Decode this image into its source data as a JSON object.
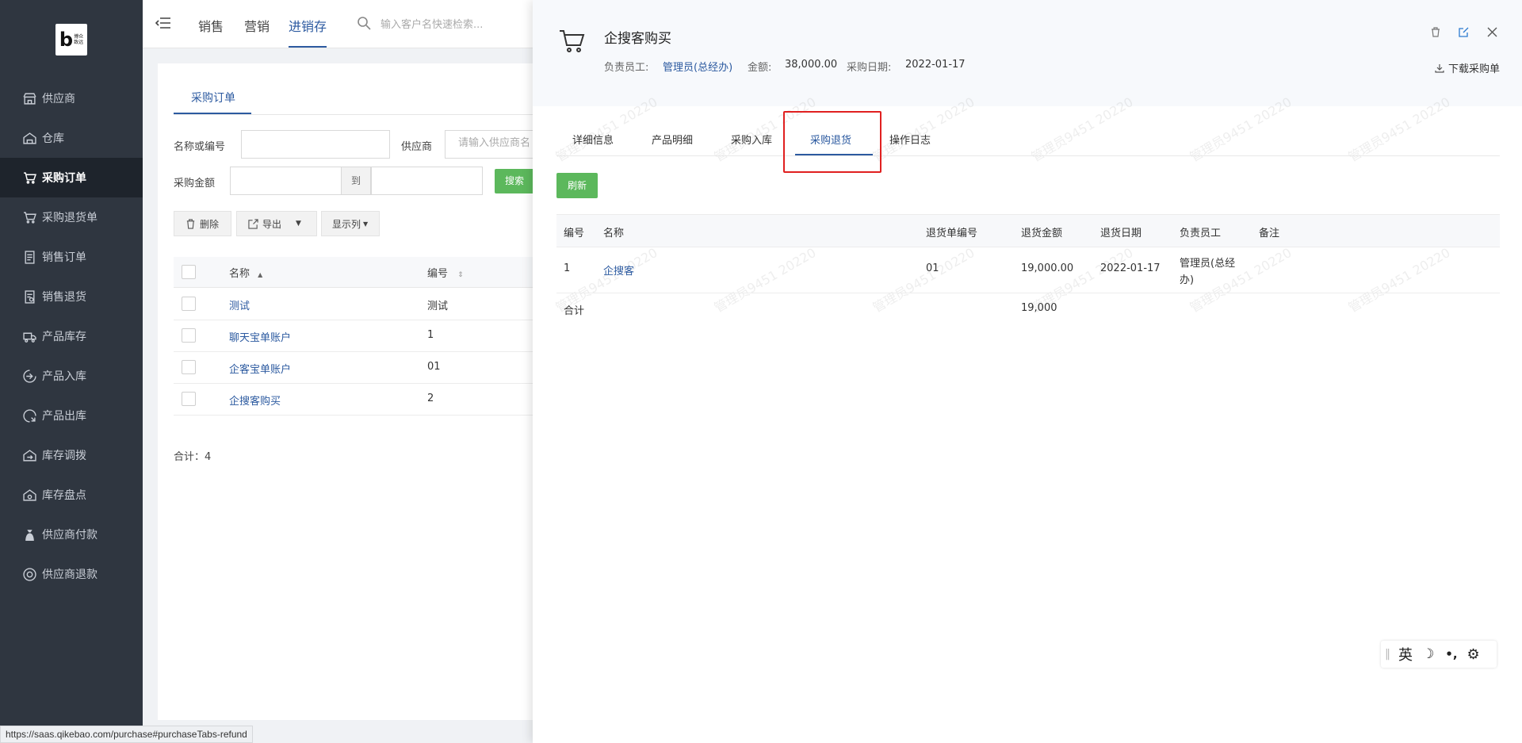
{
  "sidebar": {
    "logo_text": "博众\n致远",
    "items": [
      {
        "label": "供应商",
        "icon": "store-icon"
      },
      {
        "label": "仓库",
        "icon": "warehouse-icon"
      },
      {
        "label": "采购订单",
        "icon": "cart-icon"
      },
      {
        "label": "采购退货单",
        "icon": "return-cart-icon"
      },
      {
        "label": "销售订单",
        "icon": "document-icon"
      },
      {
        "label": "销售退货",
        "icon": "document-return-icon"
      },
      {
        "label": "产品库存",
        "icon": "truck-icon"
      },
      {
        "label": "产品入库",
        "icon": "inbound-icon"
      },
      {
        "label": "产品出库",
        "icon": "outbound-icon"
      },
      {
        "label": "库存调拨",
        "icon": "transfer-icon"
      },
      {
        "label": "库存盘点",
        "icon": "inventory-check-icon"
      },
      {
        "label": "供应商付款",
        "icon": "money-bag-icon"
      },
      {
        "label": "供应商退款",
        "icon": "refund-icon"
      }
    ],
    "active_index": 2
  },
  "topbar": {
    "tabs": [
      "销售",
      "营销",
      "进销存"
    ],
    "active_tab": "进销存",
    "search_placeholder": "输入客户名快速检索..."
  },
  "main": {
    "tab": "采购订单",
    "filters": {
      "name_label": "名称或编号",
      "supplier_label": "供应商",
      "supplier_placeholder": "请输入供应商名",
      "amount_label": "采购金额",
      "to_label": "到",
      "search_button": "搜索"
    },
    "toolbar": {
      "delete": "删除",
      "export": "导出",
      "columns": "显示列"
    },
    "columns": {
      "name": "名称",
      "code": "编号"
    },
    "rows": [
      {
        "name": "测试",
        "code": "测试"
      },
      {
        "name": "聊天宝单账户",
        "code": "1"
      },
      {
        "name": "企客宝单账户",
        "code": "01"
      },
      {
        "name": "企搜客购买",
        "code": "2"
      }
    ],
    "total": "合计：4"
  },
  "drawer": {
    "title": "企搜客购买",
    "owner_label": "负责员工:",
    "owner_value": "管理员(总经办)",
    "amount_label": "金额:",
    "amount_value": "38,000.00",
    "date_label": "采购日期:",
    "date_value": "2022-01-17",
    "download": "下载采购单",
    "tabs": [
      "详细信息",
      "产品明细",
      "采购入库",
      "采购退货",
      "操作日志"
    ],
    "active_tab": "采购退货",
    "refresh": "刷新",
    "table": {
      "headers": [
        "编号",
        "名称",
        "退货单编号",
        "退货金额",
        "退货日期",
        "负责员工",
        "备注"
      ],
      "row": {
        "id": "1",
        "name": "企搜客",
        "return_no": "01",
        "amount": "19,000.00",
        "date": "2022-01-17",
        "owner_line1": "管理员(总经",
        "owner_line2": "办)"
      },
      "sum_label": "合计",
      "sum_value": "19,000"
    },
    "watermark": "管理员9451 20220"
  },
  "ime": {
    "lang": "英",
    "moon": "☽",
    "punct": "•,",
    "gear": "⚙"
  },
  "status_url": "https://saas.qikebao.com/purchase#purchaseTabs-refund",
  "colors": {
    "accent": "#2c5aa0",
    "green": "#5cb85c",
    "sidebar": "#2f3640",
    "highlight": "#e02020"
  }
}
